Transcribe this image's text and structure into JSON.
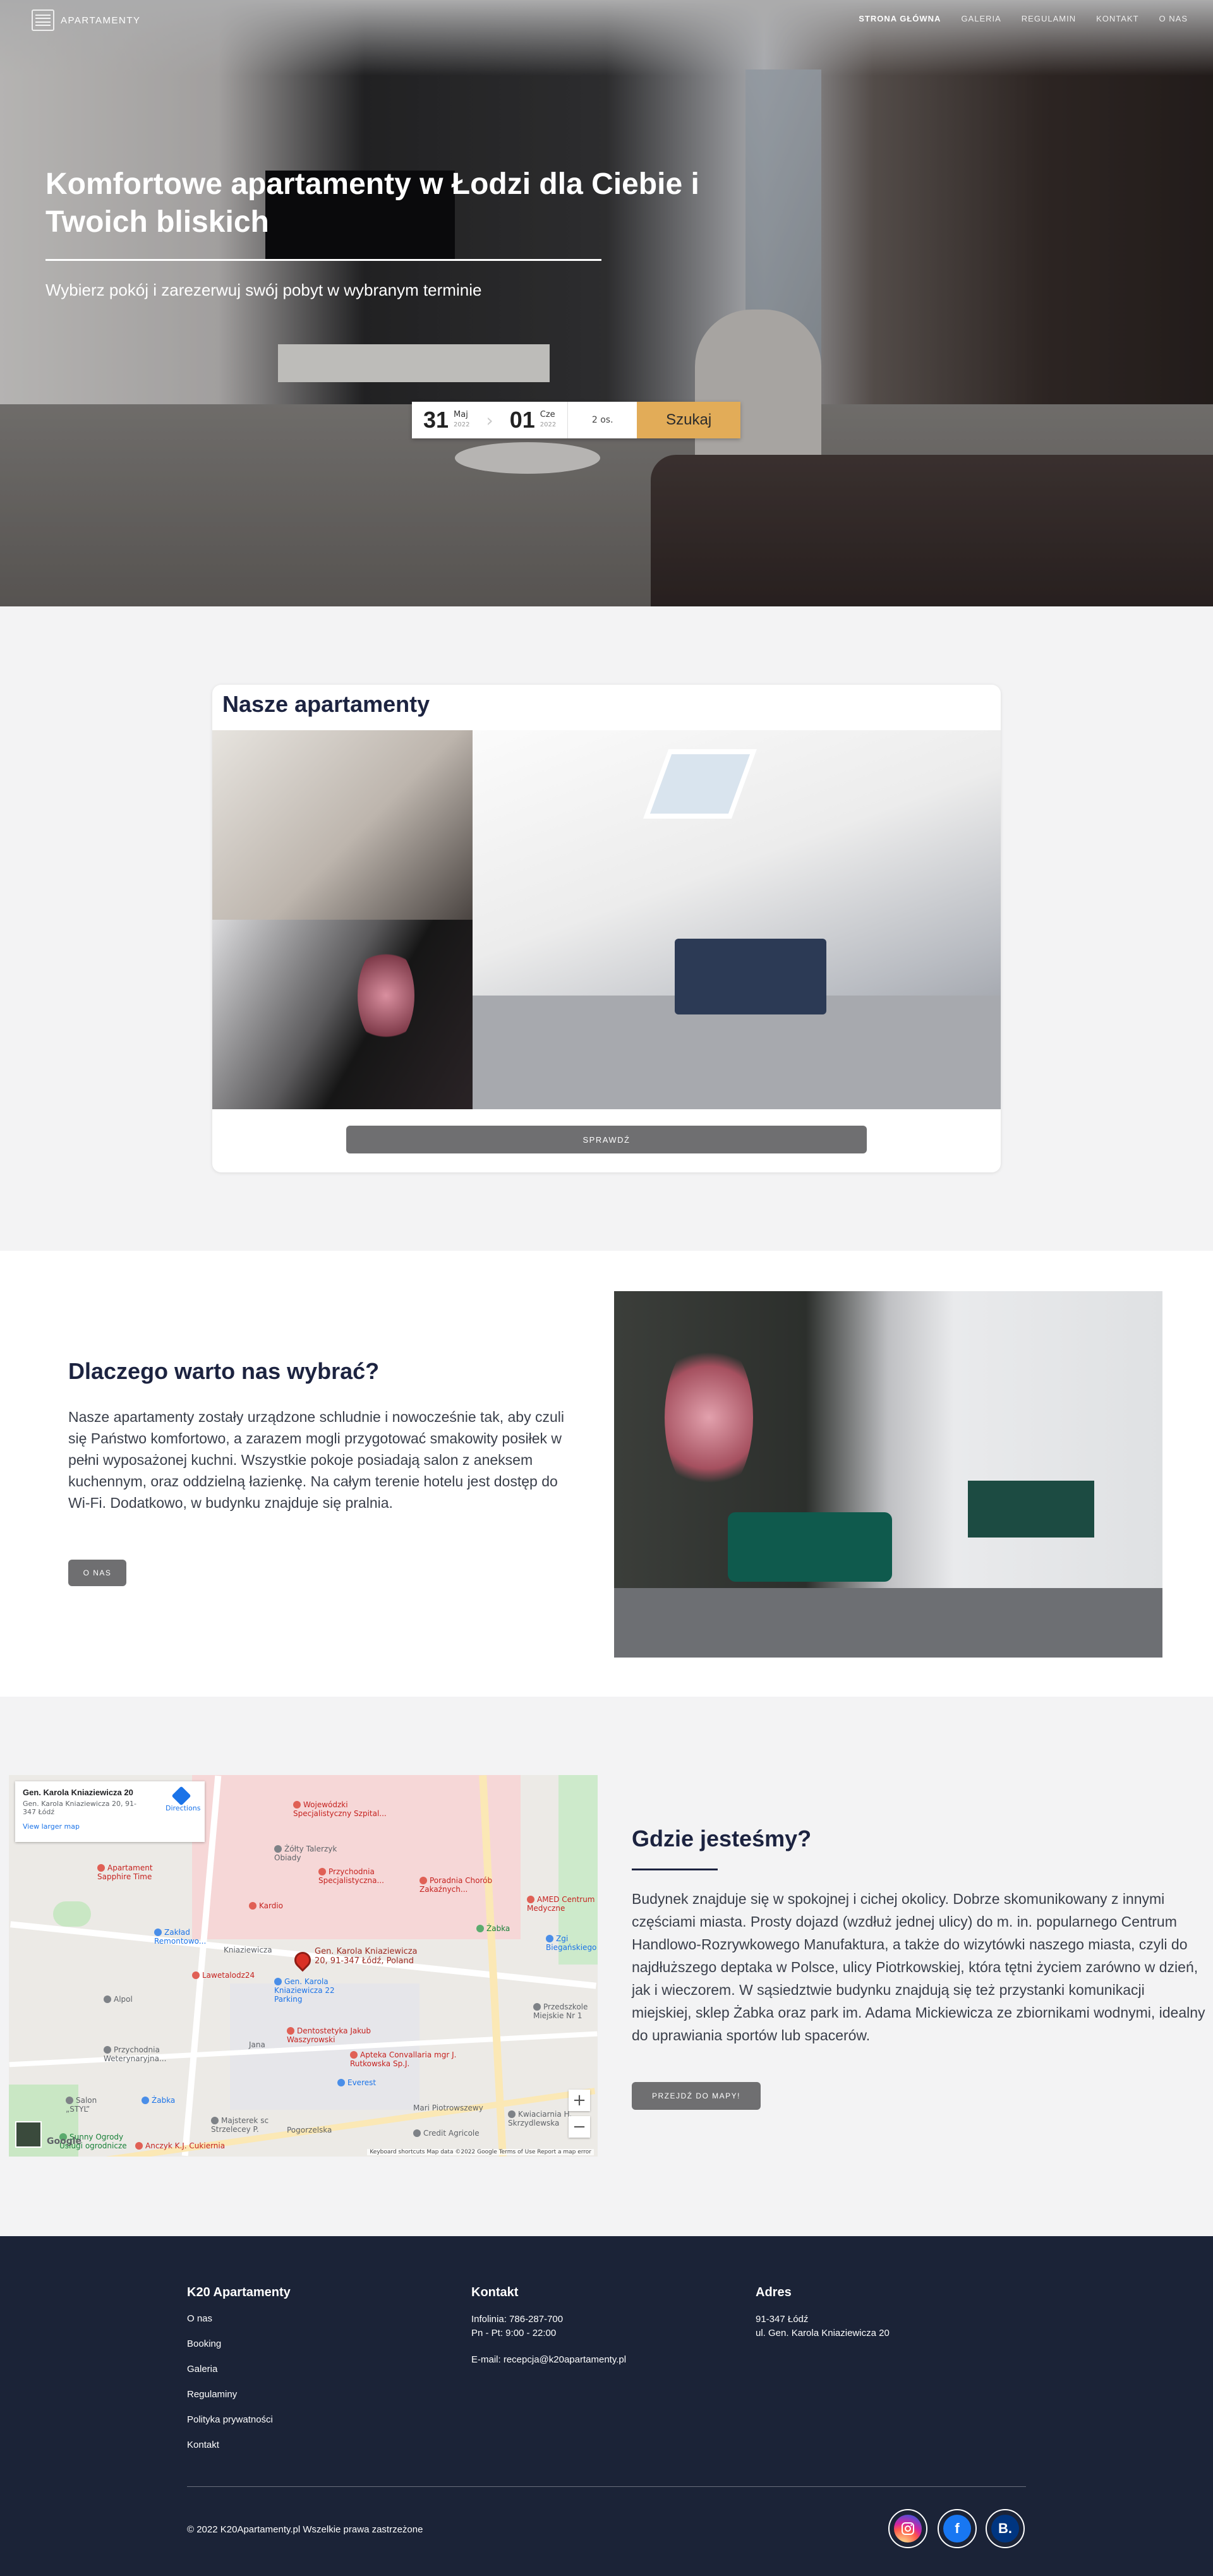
{
  "nav": {
    "brand": "APARTAMENTY",
    "menu": [
      {
        "label": "STRONA GŁÓWNA"
      },
      {
        "label": "GALERIA"
      },
      {
        "label": "REGULAMIN"
      },
      {
        "label": "KONTAKT"
      },
      {
        "label": "O NAS"
      }
    ]
  },
  "hero": {
    "title": "Komfortowe apartamenty w Łodzi dla Ciebie i Twoich bliskich",
    "subtitle": "Wybierz pokój i zarezerwuj swój pobyt w wybranym terminie"
  },
  "booking": {
    "checkin_day": "31",
    "checkin_month": "Maj",
    "checkin_year": "2022",
    "checkout_day": "01",
    "checkout_month": "Cze",
    "checkout_year": "2022",
    "guests": "2 os.",
    "search_label": "Szukaj"
  },
  "apartments": {
    "title": "Nasze apartamenty",
    "button": "SPRAWDŹ"
  },
  "why": {
    "title": "Dlaczego warto nas wybrać?",
    "text": "Nasze apartamenty zostały urządzone schludnie i nowocześnie tak, aby czuli się Państwo komfortowo, a zarazem mogli przygotować smakowity posiłek w pełni wyposażonej kuchni. Wszystkie pokoje posiadają salon z aneksem kuchennym, oraz oddzielną łazienkę. Na całym terenie hotelu jest dostęp do Wi-Fi. Dodatkowo, w budynku znajduje się pralnia.",
    "button": "O NAS"
  },
  "location": {
    "title": "Gdzie jesteśmy?",
    "text": "Budynek znajduje się w spokojnej i cichej okolicy. Dobrze skomunikowany z innymi częściami miasta. Prosty dojazd (wzdłuż jednej ulicy) do m. in. popularnego Centrum Handlowo-Rozrywkowego Manufaktura, a także do wizytówki naszego miasta, czyli do najdłuższego deptaka w Polsce, ulicy Piotrkowskiej, która tętni życiem zarówno w dzień, jak i wieczorem. W sąsiedztwie budynku znajdują się też przystanki komunikacji miejskiej, sklep Żabka oraz park im. Adama Mickiewicza ze zbiornikami wodnymi, idealny do uprawiania sportów lub spacerów.",
    "button": "PRZEJDŹ DO MAPY!"
  },
  "map": {
    "card_title": "Gen. Karola Kniaziewicza 20",
    "card_address": "Gen. Karola Kniaziewicza 20, 91-347 Łódź",
    "card_link": "View larger map",
    "directions": "Directions",
    "pin_label": "Gen. Karola Kniaziewicza 20, 91-347 Łódź, Poland",
    "footer": "Keyboard shortcuts   Map data ©2022 Google   Terms of Use   Report a map error",
    "google": "Google",
    "pois": [
      {
        "label": "Wojewódzki Specjalistyczny Szpital...",
        "color": "red"
      },
      {
        "label": "Żółty Talerzyk Obiady",
        "color": "gray"
      },
      {
        "label": "Przychodnia Specjalistyczna...",
        "color": "red"
      },
      {
        "label": "Poradnia Chorób Zakaźnych...",
        "color": "red"
      },
      {
        "label": "AMED Centrum Medyczne",
        "color": "red"
      },
      {
        "label": "Apartament Sapphire Time",
        "color": "red"
      },
      {
        "label": "Kardio",
        "color": "red"
      },
      {
        "label": "Zakład Remontowo...",
        "color": "blue"
      },
      {
        "label": "Lawetalodz24",
        "color": "red"
      },
      {
        "label": "Żabka",
        "color": "green"
      },
      {
        "label": "Gen. Karola Kniaziewicza 22 Parking",
        "color": "blue"
      },
      {
        "label": "Alpol",
        "color": "gray"
      },
      {
        "label": "Dentostetyka Jakub Waszyrowski",
        "color": "red"
      },
      {
        "label": "Apteka Convallaria mgr J. Rutkowska Sp.J.",
        "color": "red"
      },
      {
        "label": "Everest",
        "color": "blue"
      },
      {
        "label": "Przychodnia Weterynaryjna...",
        "color": "gray"
      },
      {
        "label": "Salon „STYL”",
        "color": "gray"
      },
      {
        "label": "Żabka",
        "color": "blue"
      },
      {
        "label": "Majsterek sc Strzelecey P.",
        "color": "gray"
      },
      {
        "label": "Sunny Ogrody Usługi ogrodnicze",
        "color": "green"
      },
      {
        "label": "Anczyk K.J. Cukiernia",
        "color": "red"
      },
      {
        "label": "Credit Agricole",
        "color": "gray"
      },
      {
        "label": "Kwiaciarnia H. Skrzydlewska",
        "color": "gray"
      },
      {
        "label": "Zgi Biegańskiego",
        "color": "blue"
      },
      {
        "label": "Przedszkole Miejskie Nr 1",
        "color": "gray"
      },
      {
        "label": "Mari Piotrowszewy",
        "color": "gray"
      },
      {
        "label": "Pogorzelska",
        "color": "gray"
      },
      {
        "label": "Jana",
        "color": "gray"
      },
      {
        "label": "Kniaziewicza",
        "color": "gray"
      }
    ]
  },
  "footer": {
    "col1_title": "K20 Apartamenty",
    "links": [
      {
        "label": "O nas"
      },
      {
        "label": "Booking"
      },
      {
        "label": "Galeria"
      },
      {
        "label": "Regulaminy"
      },
      {
        "label": "Polityka prywatności"
      },
      {
        "label": "Kontakt"
      }
    ],
    "col2_title": "Kontakt",
    "phone": "Infolinia: 786-287-700",
    "hours": "Pn - Pt: 9:00 - 22:00",
    "email": "E-mail: recepcja@k20apartamenty.pl",
    "col3_title": "Adres",
    "address1": "91-347 Łódź",
    "address2": "ul. Gen. Karola Kniaziewicza 20",
    "copyright": "© 2022 K20Apartamenty.pl Wszelkie prawa zastrzeżone",
    "social": [
      {
        "icon": "instagram-icon"
      },
      {
        "icon": "facebook-icon",
        "glyph": "f"
      },
      {
        "icon": "booking-icon",
        "glyph": "B."
      }
    ]
  },
  "colors": {
    "accent": "#e2ac58",
    "navy": "#1b2337",
    "button_gray": "#6f6f71",
    "section_bg": "#f3f3f4"
  }
}
